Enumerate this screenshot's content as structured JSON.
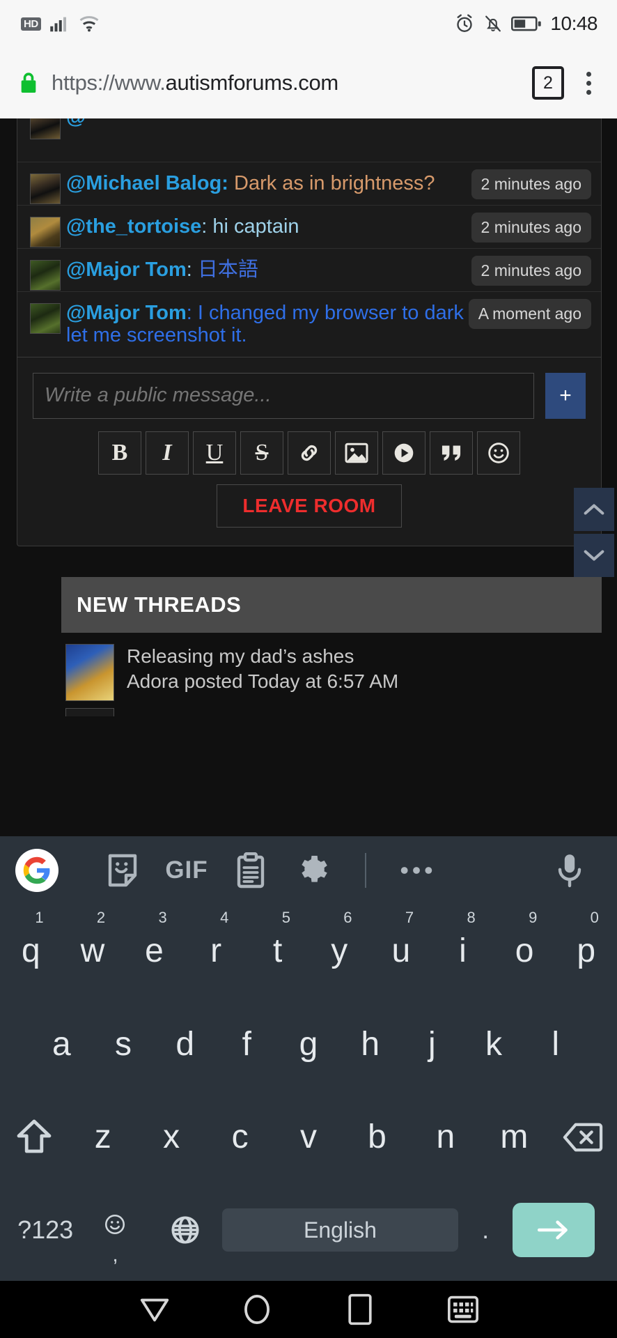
{
  "status_bar": {
    "hd_badge": "HD",
    "time": "10:48",
    "icons": [
      "hd-icon",
      "cellular-signal-icon",
      "wifi-icon",
      "alarm-icon",
      "bell-muted-icon",
      "battery-icon"
    ]
  },
  "browser": {
    "url_prefix": "https://www.",
    "url_domain": "autismforums.com",
    "lock_icon": "lock-icon",
    "tab_count": "2",
    "menu_icon": "kebab-menu-icon"
  },
  "chat": {
    "messages": [
      {
        "at": "@",
        "user": "",
        "sep": "",
        "body": "",
        "body_class": "body-plain",
        "time": "",
        "avatar": "av-dog",
        "cut": true
      },
      {
        "at": "@",
        "user": "Michael Balog",
        "sep": ":",
        "body": "Dark as in brightness?",
        "body_class": "body-orange",
        "time": "2 minutes ago",
        "avatar": "av-dog",
        "cut": false
      },
      {
        "at": "@",
        "user": "the_tortoise",
        "sep": ":",
        "body": "hi captain",
        "body_class": "body-plain",
        "time": "2 minutes ago",
        "avatar": "av-tort",
        "cut": false
      },
      {
        "at": "@",
        "user": "Major Tom",
        "sep": ":",
        "body": "日本語",
        "body_class": "body-jp",
        "time": "2 minutes ago",
        "avatar": "av-tom",
        "cut": false
      },
      {
        "at": "@",
        "user": "Major Tom",
        "sep": ":",
        "body": "I changed my browser to dark mode here let me screenshot it.",
        "body_class": "body-blue",
        "time": "A moment ago",
        "avatar": "av-tom",
        "cut": false
      }
    ],
    "composer": {
      "placeholder": "Write a public message...",
      "value": "",
      "add_label": "+",
      "format_buttons": [
        {
          "label": "B",
          "name": "bold-button",
          "cls": "serif fmt-b"
        },
        {
          "label": "I",
          "name": "italic-button",
          "cls": "serif fmt-i"
        },
        {
          "label": "U",
          "name": "underline-button",
          "cls": "serif fmt-u"
        },
        {
          "label": "S",
          "name": "strikethrough-button",
          "cls": "serif fmt-s"
        },
        {
          "label": "",
          "name": "link-icon-button",
          "cls": ""
        },
        {
          "label": "",
          "name": "image-icon-button",
          "cls": ""
        },
        {
          "label": "",
          "name": "media-play-icon-button",
          "cls": ""
        },
        {
          "label": "",
          "name": "quote-icon-button",
          "cls": ""
        },
        {
          "label": "",
          "name": "smiley-icon-button",
          "cls": ""
        }
      ],
      "leave_label": "LEAVE ROOM"
    },
    "scroll_up_icon": "chevron-up-icon",
    "scroll_down_icon": "chevron-down-icon"
  },
  "new_threads": {
    "header": "NEW THREADS",
    "items": [
      {
        "title": "Releasing my dad’s ashes",
        "meta": "Adora posted Today at 6:57 AM"
      }
    ]
  },
  "keyboard": {
    "toolbar": [
      {
        "name": "google-logo-icon",
        "label": ""
      },
      {
        "name": "sticker-icon",
        "label": ""
      },
      {
        "name": "gif-icon",
        "label": "GIF"
      },
      {
        "name": "clipboard-icon",
        "label": ""
      },
      {
        "name": "gear-icon",
        "label": ""
      },
      {
        "name": "more-options-icon",
        "label": ""
      },
      {
        "name": "microphone-icon",
        "label": ""
      }
    ],
    "row1": [
      {
        "key": "q",
        "num": "1"
      },
      {
        "key": "w",
        "num": "2"
      },
      {
        "key": "e",
        "num": "3"
      },
      {
        "key": "r",
        "num": "4"
      },
      {
        "key": "t",
        "num": "5"
      },
      {
        "key": "y",
        "num": "6"
      },
      {
        "key": "u",
        "num": "7"
      },
      {
        "key": "i",
        "num": "8"
      },
      {
        "key": "o",
        "num": "9"
      },
      {
        "key": "p",
        "num": "0"
      }
    ],
    "row2": [
      "a",
      "s",
      "d",
      "f",
      "g",
      "h",
      "j",
      "k",
      "l"
    ],
    "row3": [
      "z",
      "x",
      "c",
      "v",
      "b",
      "n",
      "m"
    ],
    "shift_icon": "shift-key-icon",
    "backspace_icon": "backspace-key-icon",
    "symbols_label": "?123",
    "emoji_icon": "emoji-key-icon",
    "comma_label": ",",
    "globe_icon": "language-globe-icon",
    "space_label": "English",
    "period_label": ".",
    "enter_icon": "enter-arrow-icon"
  },
  "nav_bar": {
    "back_icon": "back-triangle-icon",
    "home_icon": "home-circle-icon",
    "recents_icon": "recents-square-icon",
    "keyboard_icon": "hide-keyboard-icon"
  },
  "colors": {
    "accent_blue": "#2a9fe0",
    "message_blue": "#2f6fe8",
    "message_orange": "#d79a6b",
    "leave_red": "#ee2d2d",
    "enter_green": "#8fd3c8",
    "keyboard_bg": "#2b333b"
  }
}
